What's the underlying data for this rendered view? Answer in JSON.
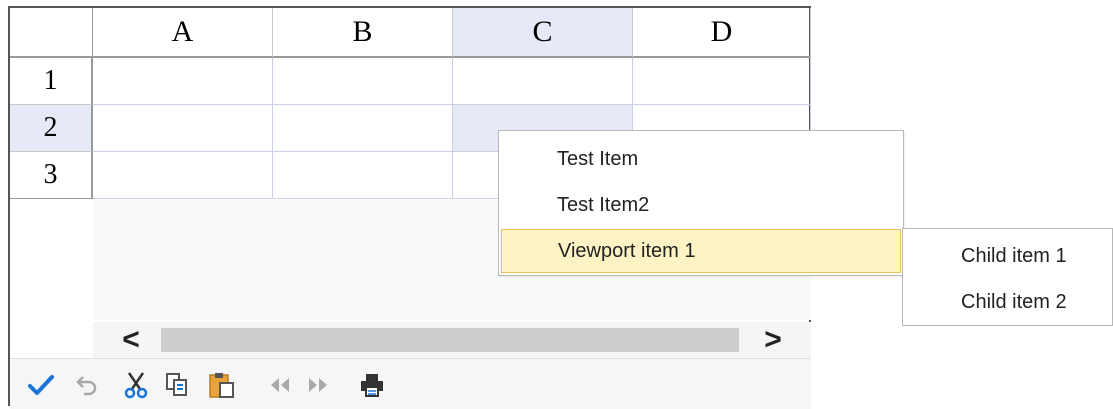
{
  "sheet": {
    "columns": [
      "A",
      "B",
      "C",
      "D"
    ],
    "rows": [
      "1",
      "2",
      "3"
    ],
    "selected_column": "C",
    "selected_row": "2"
  },
  "scrollbar": {
    "left_arrow": "<",
    "right_arrow": ">"
  },
  "toolbar": {
    "icons": [
      "check-icon",
      "undo-icon",
      "cut-icon",
      "copy-icon",
      "paste-icon",
      "rewind-icon",
      "fast-forward-icon",
      "print-icon"
    ],
    "check_color": "#1a73d6"
  },
  "context_menu": {
    "items": [
      {
        "label": "Test Item"
      },
      {
        "label": "Test Item2"
      },
      {
        "label": "Viewport item 1"
      }
    ],
    "submenu": {
      "items": [
        {
          "label": "Child item 1"
        },
        {
          "label": "Child item 2"
        }
      ]
    },
    "highlight_color": "#fdf3c4"
  }
}
